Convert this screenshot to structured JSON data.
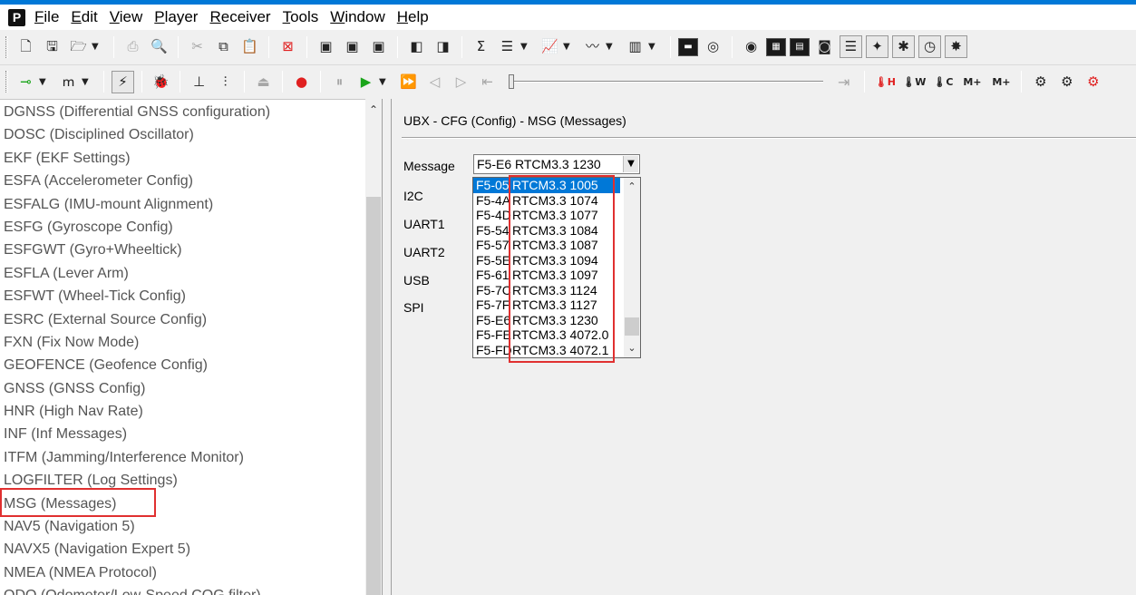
{
  "app_icon": "P",
  "menu": [
    "File",
    "Edit",
    "View",
    "Player",
    "Receiver",
    "Tools",
    "Window",
    "Help"
  ],
  "tree_items": [
    "DGNSS (Differential GNSS configuration)",
    "DOSC (Disciplined Oscillator)",
    "EKF (EKF Settings)",
    "ESFA (Accelerometer Config)",
    "ESFALG (IMU-mount Alignment)",
    "ESFG (Gyroscope Config)",
    "ESFGWT (Gyro+Wheeltick)",
    "ESFLA (Lever Arm)",
    "ESFWT (Wheel-Tick Config)",
    "ESRC (External Source Config)",
    "FXN (Fix Now Mode)",
    "GEOFENCE (Geofence Config)",
    "GNSS (GNSS Config)",
    "HNR (High Nav Rate)",
    "INF (Inf Messages)",
    "ITFM (Jamming/Interference Monitor)",
    "LOGFILTER (Log Settings)",
    "MSG (Messages)",
    "NAV5 (Navigation 5)",
    "NAVX5 (Navigation Expert 5)",
    "NMEA (NMEA Protocol)",
    "ODO (Odometer/Low-Speed COG filter)"
  ],
  "panel": {
    "title": "UBX - CFG (Config) - MSG (Messages)",
    "labels": {
      "message": "Message",
      "i2c": "I2C",
      "uart1": "UART1",
      "uart2": "UART2",
      "usb": "USB",
      "spi": "SPI"
    },
    "message_value": "F5-E6 RTCM3.3 1230"
  },
  "dropdown_options": [
    {
      "code": "F5-05",
      "name": "RTCM3.3 1005",
      "selected": true
    },
    {
      "code": "F5-4A",
      "name": "RTCM3.3 1074"
    },
    {
      "code": "F5-4D",
      "name": "RTCM3.3 1077"
    },
    {
      "code": "F5-54",
      "name": "RTCM3.3 1084"
    },
    {
      "code": "F5-57",
      "name": "RTCM3.3 1087"
    },
    {
      "code": "F5-5E",
      "name": "RTCM3.3 1094"
    },
    {
      "code": "F5-61",
      "name": "RTCM3.3 1097"
    },
    {
      "code": "F5-7C",
      "name": "RTCM3.3 1124"
    },
    {
      "code": "F5-7F",
      "name": "RTCM3.3 1127"
    },
    {
      "code": "F5-E6",
      "name": "RTCM3.3 1230"
    },
    {
      "code": "F5-FE",
      "name": "RTCM3.3 4072.0"
    },
    {
      "code": "F5-FD",
      "name": "RTCM3.3 4072.1"
    }
  ],
  "toolbar_icons": {
    "row1": [
      "new-file-icon",
      "save-icon",
      "open-folder-icon",
      "print-icon",
      "print-preview-icon",
      "cut-icon",
      "copy-icon",
      "paste-icon",
      "clear-icon",
      "docking-window-icon",
      "docking-window-2-icon",
      "docking-window-3-icon",
      "view-left-icon",
      "view-right-icon",
      "sum-icon",
      "table-view-icon",
      "chart-icon",
      "graph-icon",
      "histogram-icon",
      "console-icon",
      "statistics-icon",
      "sky-view-icon",
      "table-icon",
      "deviation-icon",
      "camera-icon",
      "list-icon",
      "compass-icon",
      "antenna-icon",
      "clock-icon",
      "spectrum-icon"
    ],
    "row2": [
      "connection-icon",
      "baud-rate-icon",
      "autobaud-icon",
      "debug-icon",
      "gnss-config-icon",
      "tune-icon",
      "eject-icon",
      "record-icon",
      "pause-icon",
      "play-icon",
      "fast-forward-icon",
      "step-back-icon",
      "step-forward-icon",
      "rewind-icon",
      "end-icon",
      "hot-start-icon",
      "warm-start-icon",
      "cold-start-icon",
      "message-add-icon",
      "message-add-2-icon",
      "settings-icon",
      "settings-2-icon",
      "settings-3-icon"
    ]
  },
  "colors": {
    "accent": "#0078d7",
    "highlight": "#e03030",
    "tree_text": "#555555"
  }
}
